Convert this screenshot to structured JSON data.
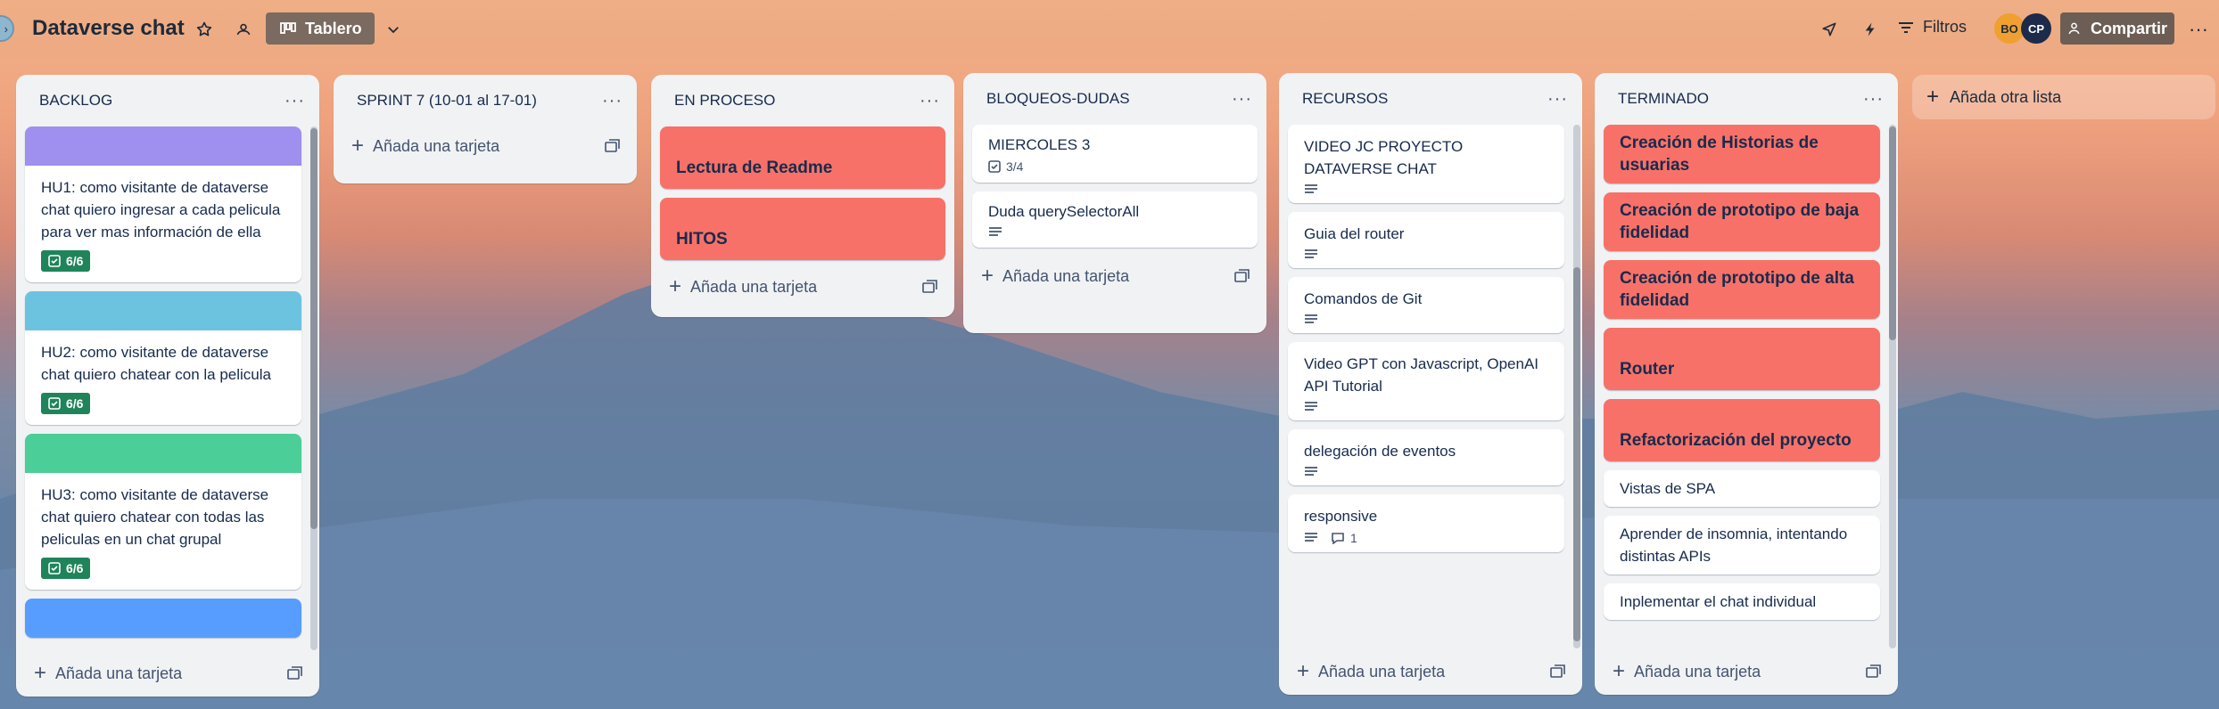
{
  "header": {
    "board_title": "Dataverse chat",
    "view_label": "Tablero",
    "filters_label": "Filtros",
    "share_label": "Compartir",
    "avatars": [
      {
        "initials": "BO",
        "color": "#f0a030"
      },
      {
        "initials": "CP",
        "color": "#1d2a4a"
      }
    ]
  },
  "add_card_label": "Añada una tarjeta",
  "add_list_label": "Añada otra lista",
  "lists": [
    {
      "title": "BACKLOG",
      "cards": [
        {
          "cover": "#9f8fef",
          "text": "HU1: como visitante de dataverse chat quiero ingresar a cada pelicula para ver mas información de ella",
          "checklist": "6/6"
        },
        {
          "cover": "#6cc3e0",
          "text": "HU2: como visitante de dataverse chat quiero chatear con la pelicula",
          "checklist": "6/6"
        },
        {
          "cover": "#4bce97",
          "text": "HU3: como visitante de dataverse chat quiero chatear con todas las peliculas en un chat grupal",
          "checklist": "6/6"
        },
        {
          "cover": "#579dff",
          "text": ""
        }
      ]
    },
    {
      "title": "SPRINT 7 (10-01 al 17-01)",
      "cards": []
    },
    {
      "title": "EN PROCESO",
      "cards": [
        {
          "label": "Lectura de Readme"
        },
        {
          "label": "HITOS"
        }
      ]
    },
    {
      "title": "BLOQUEOS-DUDAS",
      "cards": [
        {
          "text": "MIERCOLES 3",
          "checklist": "3/4"
        },
        {
          "text": "Duda querySelectorAll",
          "description": true
        }
      ]
    },
    {
      "title": "RECURSOS",
      "cards": [
        {
          "text": "VIDEO JC PROYECTO DATAVERSE CHAT"
        },
        {
          "text": "Guia del router"
        },
        {
          "text": "Comandos de Git"
        },
        {
          "text": "Video GPT con Javascript, OpenAI API Tutorial"
        },
        {
          "text": "delegación de eventos"
        },
        {
          "text": "responsive",
          "comments": "1"
        }
      ]
    },
    {
      "title": "TERMINADO",
      "cards": [
        {
          "label": "Creación de Historias de usuarias"
        },
        {
          "label": "Creación de prototipo de baja fidelidad"
        },
        {
          "label": "Creación de prototipo de alta fidelidad"
        },
        {
          "label": "Router"
        },
        {
          "label": "Refactorización del proyecto"
        },
        {
          "text": "Vistas de SPA"
        },
        {
          "text": "Aprender de insomnia, intentando distintas APIs"
        },
        {
          "text": "Inplementar el chat individual"
        }
      ]
    }
  ],
  "colors": {
    "label_red": "#f87168",
    "checklist_green": "#1f845a",
    "list_bg": "#f1f2f4",
    "share_bg": "#6c5e55"
  }
}
